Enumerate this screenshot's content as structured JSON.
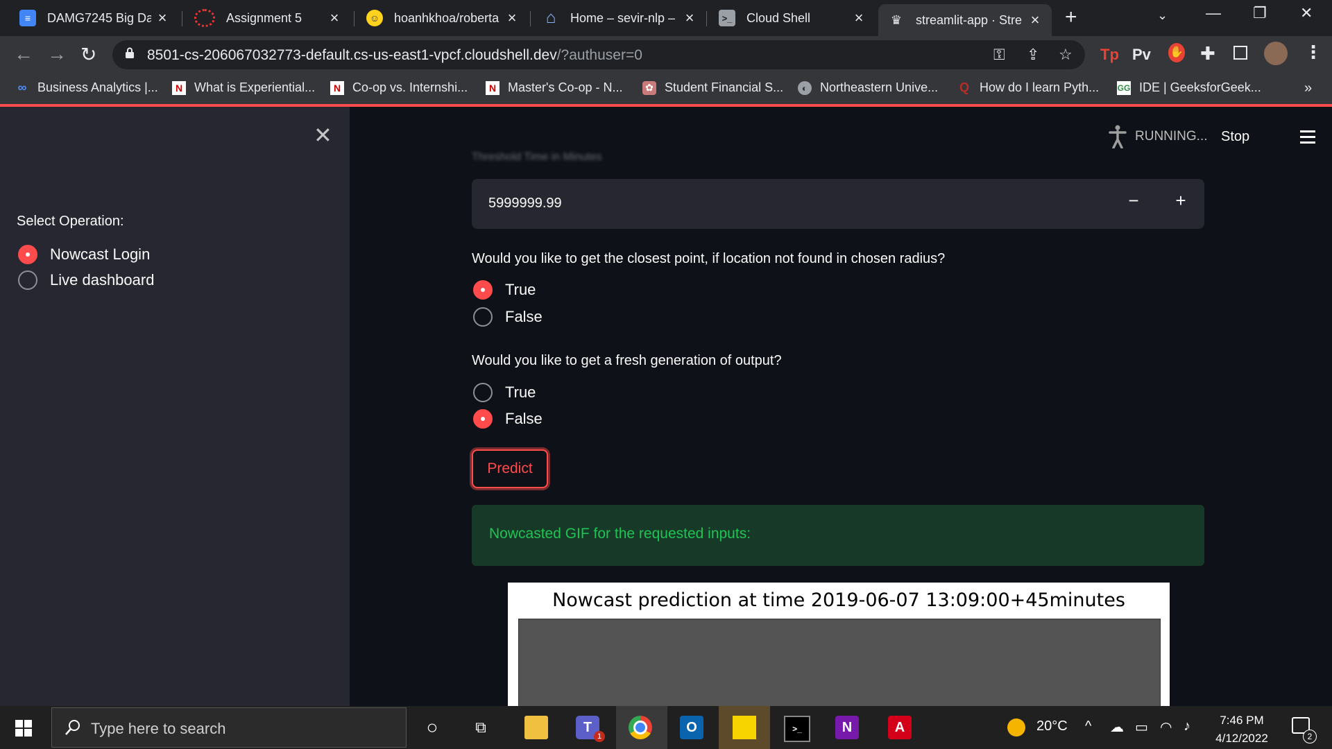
{
  "browser": {
    "tabs": [
      {
        "title": "DAMG7245 Big Dat",
        "icon": "google-docs-icon",
        "active": false
      },
      {
        "title": "Assignment 5",
        "icon": "canvas-icon",
        "active": false
      },
      {
        "title": "hoanhkhoa/roberta",
        "icon": "huggingface-icon",
        "active": false
      },
      {
        "title": "Home – sevir-nlp –",
        "icon": "home-icon",
        "active": false
      },
      {
        "title": "Cloud Shell",
        "icon": "cloud-shell-icon",
        "active": false
      },
      {
        "title": "streamlit-app · Stre",
        "icon": "streamlit-icon",
        "active": true
      }
    ],
    "url_host": "8501-cs-206067032773-default.cs-us-east1-vpcf.cloudshell.dev",
    "url_path": "/?authuser=0",
    "extensions": [
      "Tp",
      "Pv"
    ],
    "bookmarks": [
      {
        "label": "Business Analytics |...",
        "icon": "coursera-icon",
        "color": "#4d8df6"
      },
      {
        "label": "What is Experiential...",
        "icon": "northeastern-icon",
        "color": "#cc0000"
      },
      {
        "label": "Co-op vs. Internshi...",
        "icon": "northeastern-icon",
        "color": "#cc0000"
      },
      {
        "label": "Master's Co-op - N...",
        "icon": "northeastern-icon",
        "color": "#cc0000"
      },
      {
        "label": "Student Financial S...",
        "icon": "seal-icon",
        "color": "#c97b7b"
      },
      {
        "label": "Northeastern Unive...",
        "icon": "globe-icon",
        "color": "#9aa0a6"
      },
      {
        "label": "How do I learn Pyth...",
        "icon": "quora-icon",
        "color": "#b92b27"
      },
      {
        "label": "IDE | GeeksforGeek...",
        "icon": "geeksforgeeks-icon",
        "color": "#2f8d46"
      }
    ]
  },
  "sidebar": {
    "label": "Select Operation:",
    "options": [
      {
        "label": "Nowcast Login",
        "selected": true
      },
      {
        "label": "Live dashboard",
        "selected": false
      }
    ]
  },
  "header": {
    "status": "RUNNING...",
    "stop": "Stop"
  },
  "form": {
    "threshold_label": "Threshold Time in Minutes",
    "threshold_value": "5999999.99",
    "q1": "Would you like to get the closest point, if location not found in chosen radius?",
    "q1_options": [
      {
        "label": "True",
        "selected": true
      },
      {
        "label": "False",
        "selected": false
      }
    ],
    "q2": "Would you like to get a fresh generation of output?",
    "q2_options": [
      {
        "label": "True",
        "selected": false
      },
      {
        "label": "False",
        "selected": true
      }
    ],
    "predict": "Predict",
    "success": "Nowcasted GIF for the requested inputs:",
    "gif_title": "Nowcast prediction at time 2019-06-07 13:09:00+45minutes"
  },
  "taskbar": {
    "search_placeholder": "Type here to search",
    "weather": "20°C",
    "time": "7:46 PM",
    "date": "4/12/2022",
    "teams_badge": "1",
    "notification_count": "2"
  },
  "colors": {
    "accent": "#ff4b4b",
    "success_text": "#21c354",
    "success_bg": "#173928",
    "sidebar_bg": "#262730",
    "main_bg": "#0e1117"
  }
}
